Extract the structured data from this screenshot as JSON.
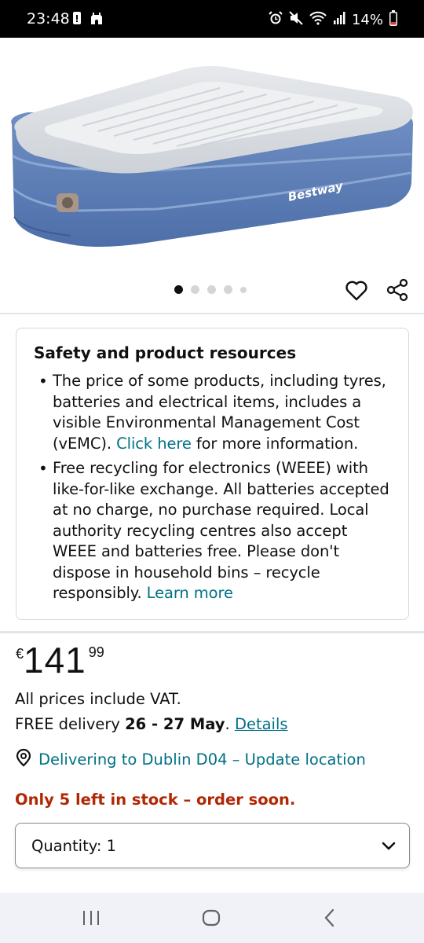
{
  "status_bar": {
    "time": "23:48",
    "battery": "14%",
    "icons": [
      "notification-icon",
      "castle-icon",
      "alarm-icon",
      "mute-icon",
      "wifi-icon",
      "signal-icon",
      "battery-icon"
    ]
  },
  "product": {
    "image_brand_text": "Bestway",
    "carousel": {
      "total": 5,
      "active": 1
    }
  },
  "resources": {
    "title": "Safety and product resources",
    "bullet1_text": "The price of some products, including tyres, batteries and electrical items, includes a visible Environmental Management Cost (vEMC). ",
    "bullet1_link": "Click here",
    "bullet1_tail": " for more information.",
    "bullet2_text": "Free recycling for electronics (WEEE) with like-for-like exchange. All batteries accepted at no charge, no purchase required. Local authority recycling centres also accept WEEE and batteries free. Please don't dispose in household bins – recycle responsibly. ",
    "bullet2_link": "Learn more"
  },
  "price": {
    "symbol": "€",
    "whole": "141",
    "fraction": "99"
  },
  "vat_text": "All prices include VAT.",
  "delivery": {
    "prefix": "FREE delivery ",
    "dates": "26 - 27 May",
    "sep": ". ",
    "details_link": "Details"
  },
  "location": {
    "text": "Delivering to Dublin D04 – Update location"
  },
  "stock": "Only 5 left in stock – order soon.",
  "quantity": {
    "label": "Quantity:",
    "value": "1"
  },
  "colors": {
    "link": "#007185",
    "stock": "#b12704",
    "text": "#0f1111"
  }
}
